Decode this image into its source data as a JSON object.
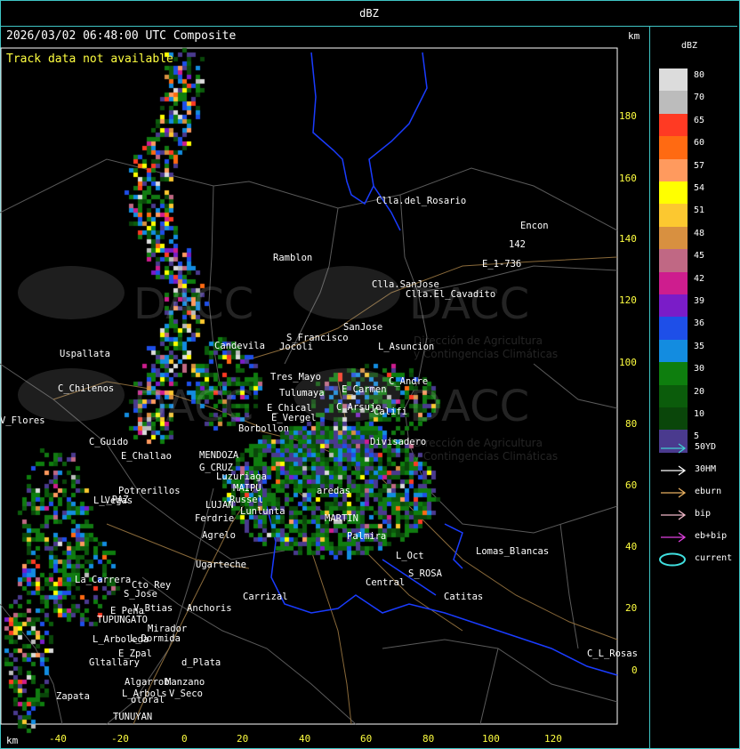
{
  "title": "dBZ",
  "timestamp": "2026/03/02 06:48:00 UTC Composite",
  "track_message": "Track data not available",
  "units": {
    "top_right": "km",
    "bottom_left": "km"
  },
  "y_ticks": [
    "180",
    "160",
    "140",
    "120",
    "100",
    "80",
    "60",
    "40",
    "20",
    "0"
  ],
  "x_ticks": [
    "-40",
    "-20",
    "0",
    "20",
    "40",
    "60",
    "80",
    "100",
    "120"
  ],
  "places": [
    "Clla.del_Rosario",
    "Encon",
    "142",
    "E_1-736",
    "Ramblon",
    "Clla.SanJose",
    "Clla.El_Cavadito",
    "SanJose",
    "S_Francisco",
    "L_Asuncion",
    "Uspallata",
    "Candevila",
    "Jocoli",
    "Tres_Mayo",
    "C_Andre",
    "E_Carmen",
    "C_Chilenos",
    "Tulumaya",
    "C_Arsujo",
    "Califi",
    "E_Chical",
    "E_Vergel",
    "Borbollon",
    "Divisadero",
    "C_Guido",
    "E_Challao",
    "MENDOZA",
    "G_CRUZ",
    "Luzuriaga",
    "Potrerillos",
    "MAIPU",
    "Russel",
    "L_Vegas",
    "LUJAN",
    "Ferdrie",
    "Lunlunta",
    "Agrelo",
    "MARTIN",
    "Palmira",
    "Ugarteche",
    "Lomas_Blancas",
    "L_Oct",
    "S_ROSA",
    "La_Carrera",
    "Cto_Rey",
    "S_Jose",
    "Carrizal",
    "Central",
    "Catitas",
    "V_Btias",
    "Anchoris",
    "E_Pena",
    "TUPUNGATO",
    "Mirador",
    "L_Dormida",
    "L_Arboleda",
    "E_Zpal",
    "Gltallary",
    "d_Plata",
    "L_Arbols",
    "Zapata",
    "Algarrob",
    "Manzano",
    "V_Seco",
    "otoral",
    "TUNUYAN",
    "C_L_Rosas",
    "V_Flores",
    "L_PAZ",
    "aredas",
    "Vegas",
    "Jumbe"
  ],
  "watermark": {
    "brand": "DACC",
    "line1": "Dirección de Agricultura",
    "line2": "y Contingencias Climáticas"
  },
  "legend": {
    "title": "dBZ",
    "rows": [
      {
        "label": "80",
        "color": "#dcdcdc"
      },
      {
        "label": "70",
        "color": "#bcbcbc"
      },
      {
        "label": "65",
        "color": "#ff3a23"
      },
      {
        "label": "60",
        "color": "#ff6a12"
      },
      {
        "label": "57",
        "color": "#ff9a5e"
      },
      {
        "label": "54",
        "color": "#ffff00"
      },
      {
        "label": "51",
        "color": "#fcc830"
      },
      {
        "label": "48",
        "color": "#d89040"
      },
      {
        "label": "45",
        "color": "#c06884"
      },
      {
        "label": "42",
        "color": "#ce1d8e"
      },
      {
        "label": "39",
        "color": "#7a1cc8"
      },
      {
        "label": "36",
        "color": "#1e4fe8"
      },
      {
        "label": "35",
        "color": "#138ce0"
      },
      {
        "label": "30",
        "color": "#0e7e0e"
      },
      {
        "label": "20",
        "color": "#0b5c0b"
      },
      {
        "label": "10",
        "color": "#0a460a"
      },
      {
        "label": "5",
        "color": "#4a3a8e"
      }
    ]
  },
  "tracks": [
    {
      "label": "50YD",
      "color": "#40d0d0"
    },
    {
      "label": "30HM",
      "color": "#ffffff"
    },
    {
      "label": "eburn",
      "color": "#e8b060"
    },
    {
      "label": "bip",
      "color": "#f0b8c8"
    },
    {
      "label": "eb+bip",
      "color": "#e040e0"
    },
    {
      "label": "current",
      "color": "#40e0e0"
    }
  ],
  "colors": {
    "frame": "#3fc5c5",
    "tick": "#ffff40",
    "border_blue": "#1a3cff",
    "roads": "#a07840",
    "terrain": "#888888"
  }
}
